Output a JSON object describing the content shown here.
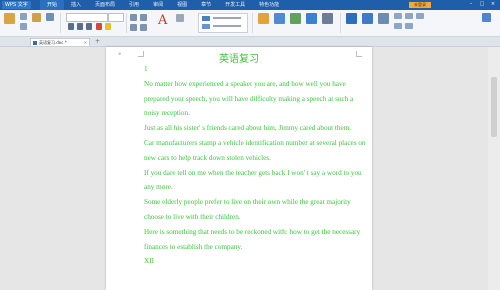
{
  "app": {
    "app_button_label": "WPS 文字",
    "menu_tabs": [
      "开始",
      "插入",
      "页面布局",
      "引用",
      "审阅",
      "视图",
      "章节",
      "开发工具",
      "特色功能"
    ],
    "update_label": "未登录"
  },
  "tabbar": {
    "doc_tab_label": "英语复习.doc *",
    "new_tab": "+"
  },
  "document": {
    "page_marker": "⊕",
    "title": "英语复习",
    "paragraphs": [
      "1",
      "No matter how experienced a speaker you are, and how well you have prepared your speech, you will have difficulty making a speech at such a noisy reception.",
      "Just as all his sister' s friends cared about him, Jimmy cared about them.",
      "Car manufacturers stamp a vehicle identification number at several places on new cars to help track down stolen vehicles.",
      "If you dare tell on me when the teacher gets back I won' t say a word to you any more.",
      "Some elderly people prefer to live on their own while the great majority choose to live with their children.",
      "Here is something that needs to be reckoned with: how to get the necessary finances to establish the company.",
      "XII"
    ]
  },
  "colors": {
    "menubar": "#1f5ea8",
    "doc_text": "#3ec43e",
    "accent": "#2b6fc0"
  }
}
